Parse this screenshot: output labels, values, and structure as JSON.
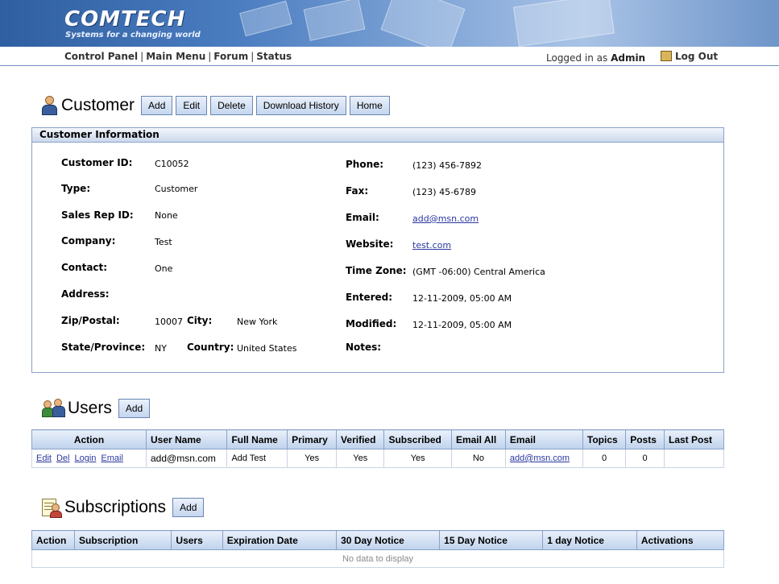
{
  "brand": {
    "logo": "COMTECH",
    "tagline": "Systems for a changing world",
    "primary_color": "#2f5fa0"
  },
  "nav": {
    "links": [
      "Control Panel",
      "Main Menu",
      "Forum",
      "Status"
    ],
    "logged_in_prefix": "Logged in as",
    "user": "Admin",
    "logout": "Log Out"
  },
  "customer": {
    "title": "Customer",
    "buttons": [
      "Add",
      "Edit",
      "Delete",
      "Download History",
      "Home"
    ],
    "panel_title": "Customer Information",
    "labels": {
      "customer_id": "Customer ID:",
      "type": "Type:",
      "sales_rep": "Sales Rep ID:",
      "company": "Company:",
      "contact": "Contact:",
      "address": "Address:",
      "zip": "Zip/Postal:",
      "city": "City:",
      "state": "State/Province:",
      "country": "Country:",
      "phone": "Phone:",
      "fax": "Fax:",
      "email": "Email:",
      "website": "Website:",
      "timezone": "Time Zone:",
      "entered": "Entered:",
      "modified": "Modified:",
      "notes": "Notes:"
    },
    "values": {
      "customer_id": "C10052",
      "type": "Customer",
      "sales_rep": "None",
      "company": "Test",
      "contact": "One",
      "zip": "10007",
      "city": "New York",
      "state": "NY",
      "country": "United States",
      "phone": "(123) 456-7892",
      "fax": "(123) 45-6789",
      "email": "add@msn.com",
      "website": "test.com",
      "timezone": "(GMT -06:00) Central America",
      "entered": "12-11-2009, 05:00 AM",
      "modified": "12-11-2009, 05:00 AM"
    }
  },
  "users": {
    "title": "Users",
    "add_label": "Add",
    "columns": [
      "Action",
      "User Name",
      "Full Name",
      "Primary",
      "Verified",
      "Subscribed",
      "Email All",
      "Email",
      "Topics",
      "Posts",
      "Last Post"
    ],
    "row_actions": [
      "Edit",
      "Del",
      "Login",
      "Email"
    ],
    "rows": [
      {
        "user_name": "add@msn.com",
        "full_name": "Add Test",
        "primary": "Yes",
        "verified": "Yes",
        "subscribed": "Yes",
        "email_all": "No",
        "email": "add@msn.com",
        "topics": "0",
        "posts": "0",
        "last_post": ""
      }
    ]
  },
  "subscriptions": {
    "title": "Subscriptions",
    "add_label": "Add",
    "columns": [
      "Action",
      "Subscription",
      "Users",
      "Expiration Date",
      "30 Day Notice",
      "15 Day Notice",
      "1 day Notice",
      "Activations"
    ],
    "empty_text": "No data to display"
  }
}
